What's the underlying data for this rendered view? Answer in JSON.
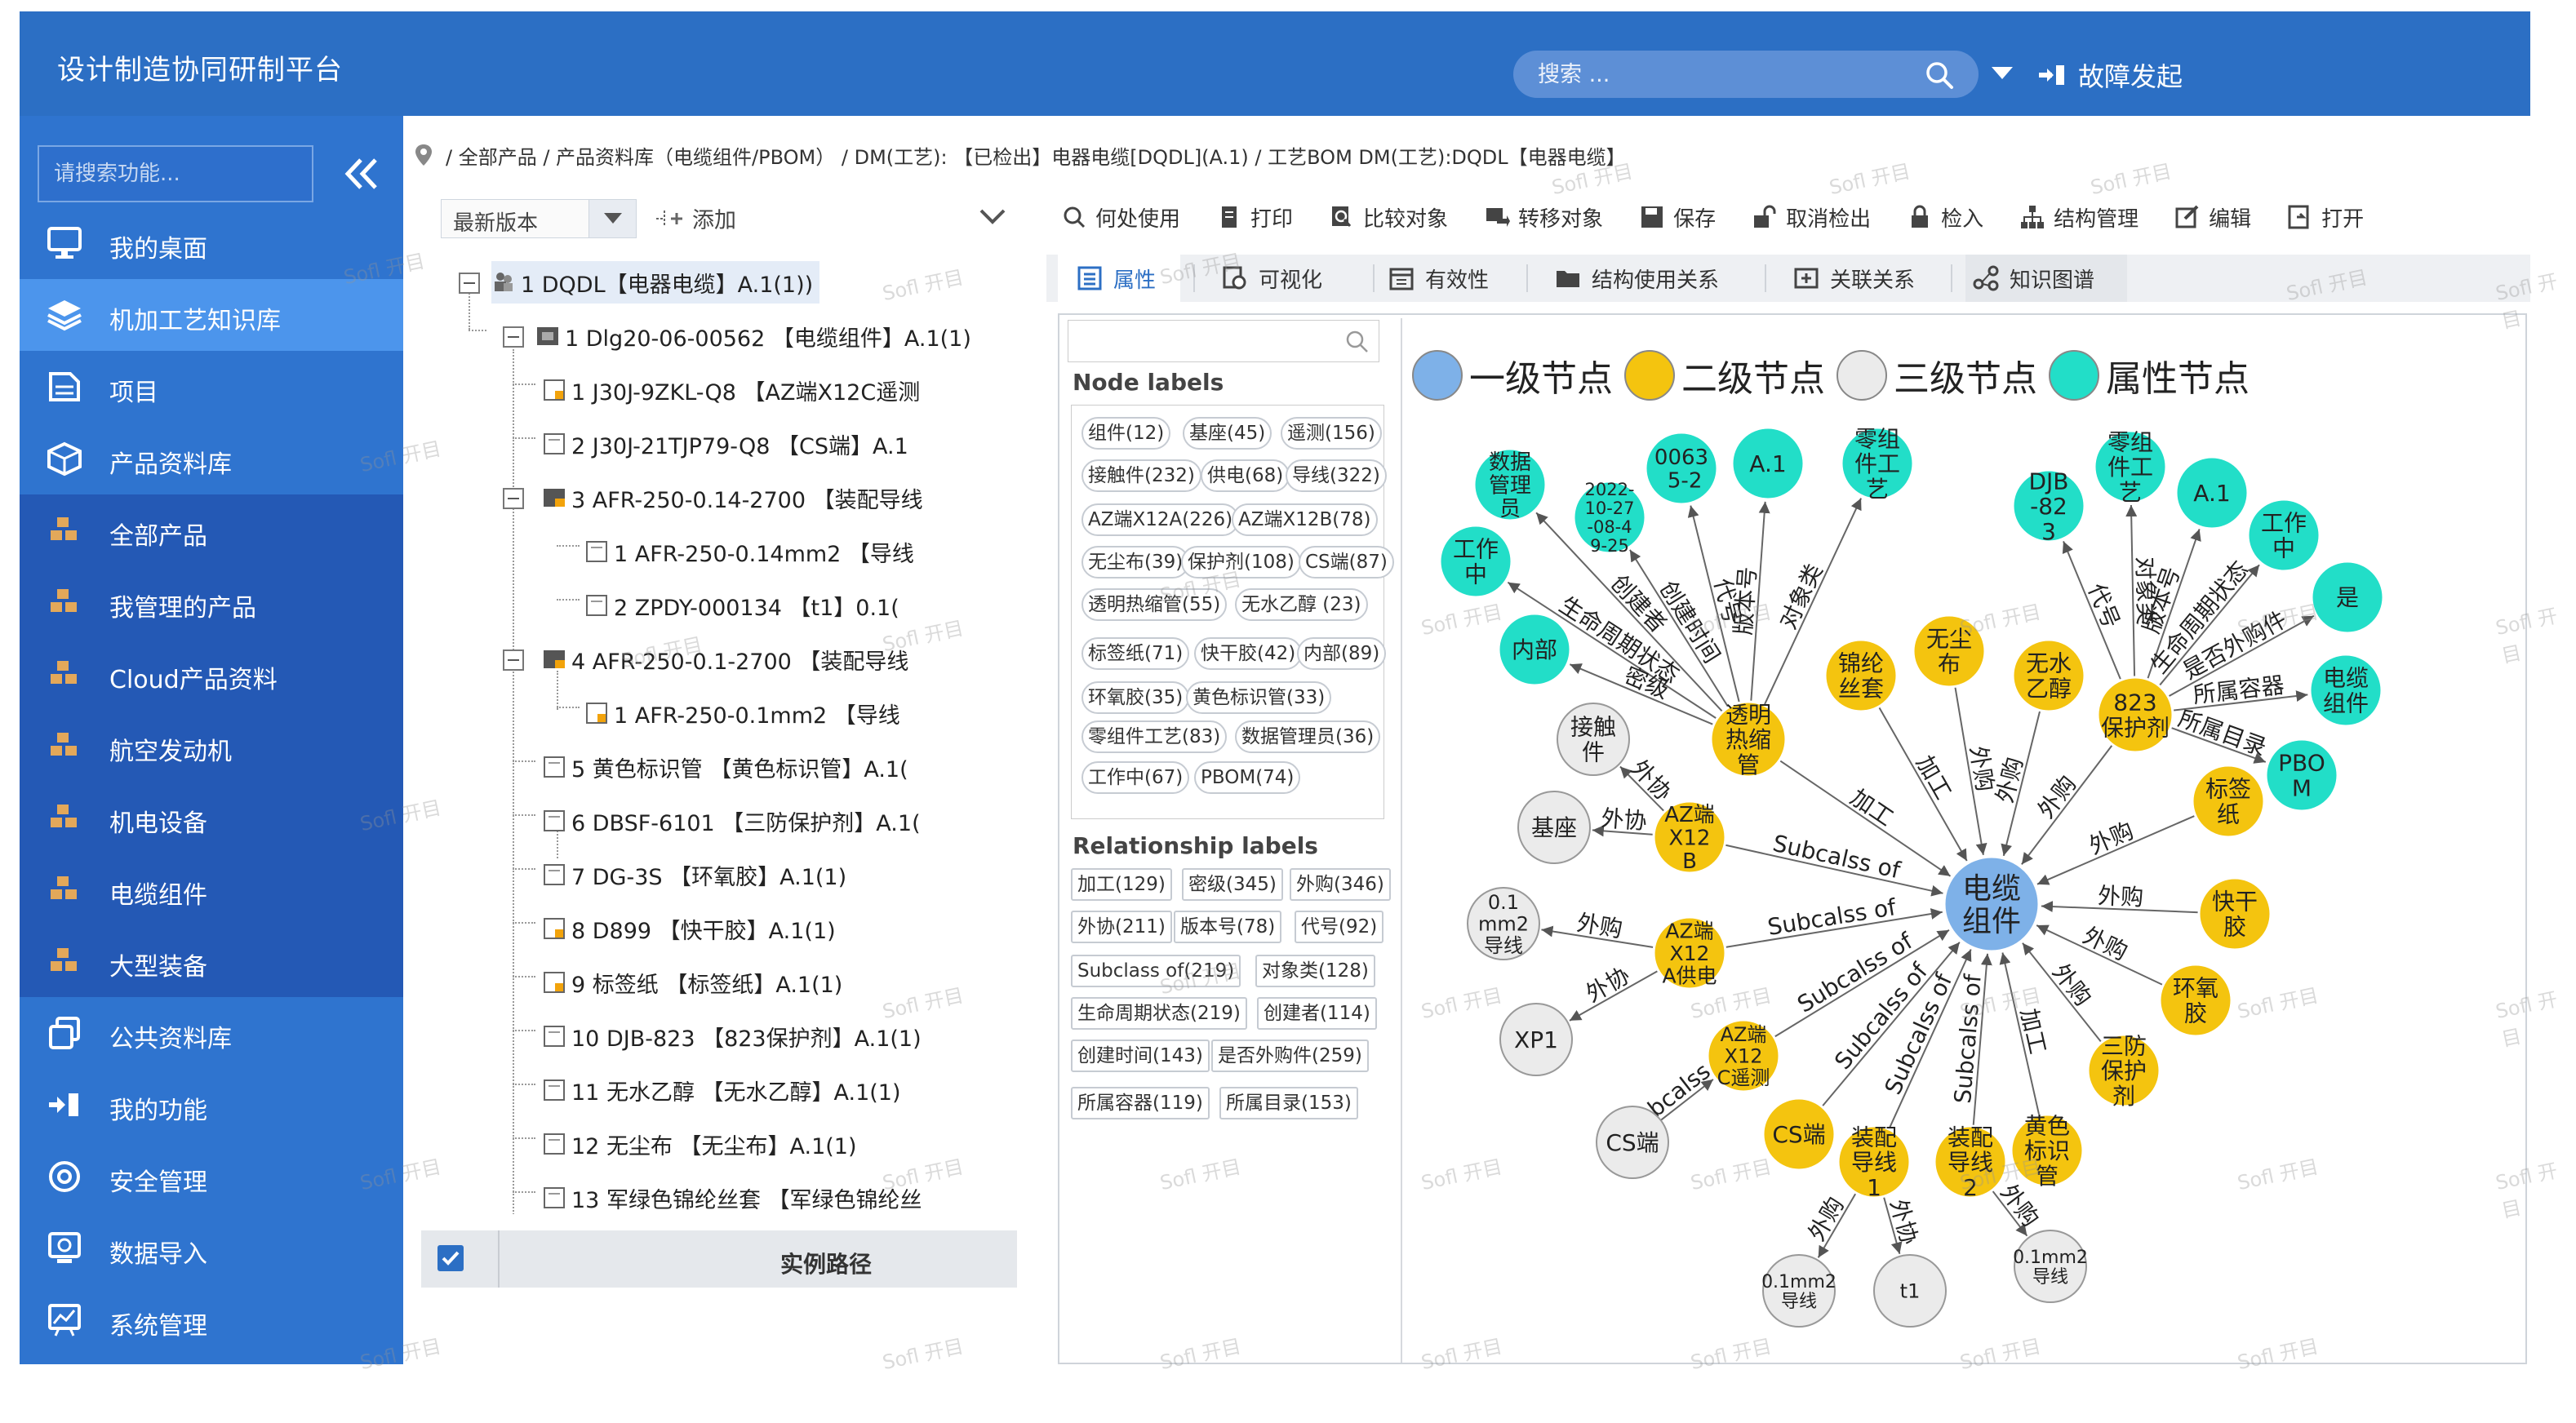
{
  "header": {
    "title": "设计制造协同研制平台",
    "search_placeholder": "搜索 ...",
    "fault_label": "故障发起"
  },
  "sidebar": {
    "search_placeholder": "请搜索功能...",
    "items": [
      {
        "label": "我的桌面",
        "icon": "desktop-icon"
      },
      {
        "label": "机加工艺知识库",
        "icon": "layers-icon"
      },
      {
        "label": "项目",
        "icon": "project-icon"
      },
      {
        "label": "产品资料库",
        "icon": "box-icon"
      },
      {
        "label": "全部产品",
        "icon": "cubes-icon"
      },
      {
        "label": "我管理的产品",
        "icon": "cubes-icon"
      },
      {
        "label": "Cloud产品资料",
        "icon": "cubes-icon"
      },
      {
        "label": "航空发动机",
        "icon": "cubes-icon"
      },
      {
        "label": "机电设备",
        "icon": "cubes-icon"
      },
      {
        "label": "电缆组件",
        "icon": "cubes-icon"
      },
      {
        "label": "大型装备",
        "icon": "cubes-icon"
      },
      {
        "label": "公共资料库",
        "icon": "library-icon"
      },
      {
        "label": "我的功能",
        "icon": "function-icon"
      },
      {
        "label": "安全管理",
        "icon": "security-icon"
      },
      {
        "label": "数据导入",
        "icon": "import-icon"
      },
      {
        "label": "系统管理",
        "icon": "system-icon"
      }
    ]
  },
  "breadcrumb": "/ 全部产品 / 产品资料库（电缆组件/PBOM） / DM(工艺): 【已检出】电器电缆[DQDL](A.1) / 工艺BOM DM(工艺):DQDL【电器电缆】",
  "tree": {
    "version_select": "最新版本",
    "add_label": "添加",
    "nodes": [
      "1 DQDL【电器电缆】A.1(1))",
      "1 Dlg20-06-00562 【电缆组件】A.1(1)",
      "1 J30J-9ZKL-Q8 【AZ端X12C遥测",
      "2 J30J-21TJP79-Q8 【CS端】A.1",
      "3 AFR-250-0.14-2700 【装配导线",
      "1 AFR-250-0.14mm2 【导线",
      "2 ZPDY-000134 【t1】0.1(",
      "4 AFR-250-0.1-2700 【装配导线",
      "1 AFR-250-0.1mm2 【导线",
      "5 黄色标识管 【黄色标识管】A.1(",
      "6 DBSF-6101 【三防保护剂】A.1(",
      "7 DG-3S 【环氧胶】A.1(1)",
      "8 D899 【快干胶】A.1(1)",
      "9 标签纸 【标签纸】A.1(1)",
      "10 DJB-823 【823保护剂】A.1(1)",
      "11 无水乙醇 【无水乙醇】A.1(1)",
      "12 无尘布 【无尘布】A.1(1)",
      "13 军绿色锦纶丝套 【军绿色锦纶丝"
    ],
    "instance_path_label": "实例路径"
  },
  "toolbar": [
    "何处使用",
    "打印",
    "比较对象",
    "转移对象",
    "保存",
    "取消检出",
    "检入",
    "结构管理",
    "编辑",
    "打开"
  ],
  "tabs": [
    "属性",
    "可视化",
    "有效性",
    "结构使用关系",
    "关联关系",
    "知识图谱"
  ],
  "labels_panel": {
    "node_labels_title": "Node labels",
    "node_labels": [
      "组件(12)",
      "基座(45)",
      "遥测(156)",
      "接触件(232)",
      "供电(68)",
      "导线(322)",
      "AZ端X12A(226)",
      "AZ端X12B(78)",
      "无尘布(39)",
      "保护剂(108)",
      "CS端(87)",
      "透明热缩管(55)",
      "无水乙醇 (23)",
      "标签纸(71)",
      "快干胶(42)",
      "内部(89)",
      "环氧胶(35)",
      "黄色标识管(33)",
      "零组件工艺(83)",
      "数据管理员(36)",
      "工作中(67)",
      "PBOM(74)"
    ],
    "relationship_labels_title": "Relationship labels",
    "relationship_labels": [
      "加工(129)",
      "密级(345)",
      "外购(346)",
      "外协(211)",
      "版本号(78)",
      "代号(92)",
      "Subclass of(219)",
      "对象类(128)",
      "生命周期状态(219)",
      "创建者(114)",
      "创建时间(143)",
      "是否外购件(259)",
      "所属容器(119)",
      "所属目录(153)"
    ]
  },
  "graph": {
    "legend": [
      {
        "label": "一级节点",
        "color": "#7eb1e8"
      },
      {
        "label": "二级节点",
        "color": "#f4c40f"
      },
      {
        "label": "三级节点",
        "color": "#ebebeb"
      },
      {
        "label": "属性节点",
        "color": "#22dec8"
      }
    ],
    "nodes": {
      "center": "电缆组件",
      "tl": "透明热缩管",
      "tl_a1": "数据管理员",
      "tl_a2": "2022-10-27-08-49-25",
      "tl_a3": "0063 5-2",
      "tl_a4": "A.1",
      "tl_a5": "零组件工艺",
      "tl_a6": "工作中",
      "tl_a7": "内部",
      "ts1": "锦纶丝套",
      "ts2": "无尘布",
      "ts3": "无水乙醇",
      "tr": "823保护剂",
      "tr_a1": "DJB-823",
      "tr_a2": "零组件工艺",
      "tr_a3": "A.1",
      "tr_a4": "工作中",
      "tr_a5": "是",
      "tr_a6": "电缆组件",
      "tr_a7": "PBOM",
      "bq": "标签纸",
      "kgj": "快干胶",
      "hyj": "环氧胶",
      "sfbh": "三防保护剂",
      "hsbs": "黄色标识管",
      "x12b": "AZ端X12B",
      "jcj": "接触件",
      "jz": "基座",
      "x12a": "AZ端X12A供电",
      "dx01": "0.1mm2导线",
      "xp1": "XP1",
      "x12c": "AZ端X12C遥测",
      "csd": "CS端",
      "cs": "CS端",
      "zp1": "装配导线1",
      "zp2": "装配导线2",
      "w1": "0.1mm2导线",
      "t1": "t1",
      "w2": "0.1mm2导线"
    },
    "edges": {
      "tl_a1": "创建者",
      "tl_a2": "创建时间",
      "tl_a3": "代号",
      "tl_a4": "版本号",
      "tl_a5": "对象类",
      "tl_a6": "生命周期状态",
      "tl_a7": "密级",
      "tl_center": "加工",
      "ts1": "加工",
      "ts2": "外购",
      "ts3": "外购",
      "tr_a1": "代号",
      "tr_a2": "对象类",
      "tr_a3": "版本号",
      "tr_a4": "生命周期状态",
      "tr_a5": "是否外购件",
      "tr_a6": "所属容器",
      "tr_a7": "所属目录",
      "tr_center": "外购",
      "bq": "外购",
      "kgj": "外购",
      "hyj": "外购",
      "sfbh": "外购",
      "hsbs": "加工",
      "x12b": "Subcalss of",
      "x12b_jcj": "外协",
      "x12b_jz": "外协",
      "x12a": "Subcalss of",
      "x12a_dx": "外购",
      "x12a_xp1": "外协",
      "x12c": "Subcalss of",
      "x12c_cs": "Subcalss of",
      "csd": "Subcalss of",
      "zp1": "Subcalss of",
      "zp2": "Subcalss of",
      "zp1_w1": "外购",
      "zp1_t1": "外协",
      "zp2_w2": "外购"
    }
  },
  "watermark": "Sofl 开目"
}
